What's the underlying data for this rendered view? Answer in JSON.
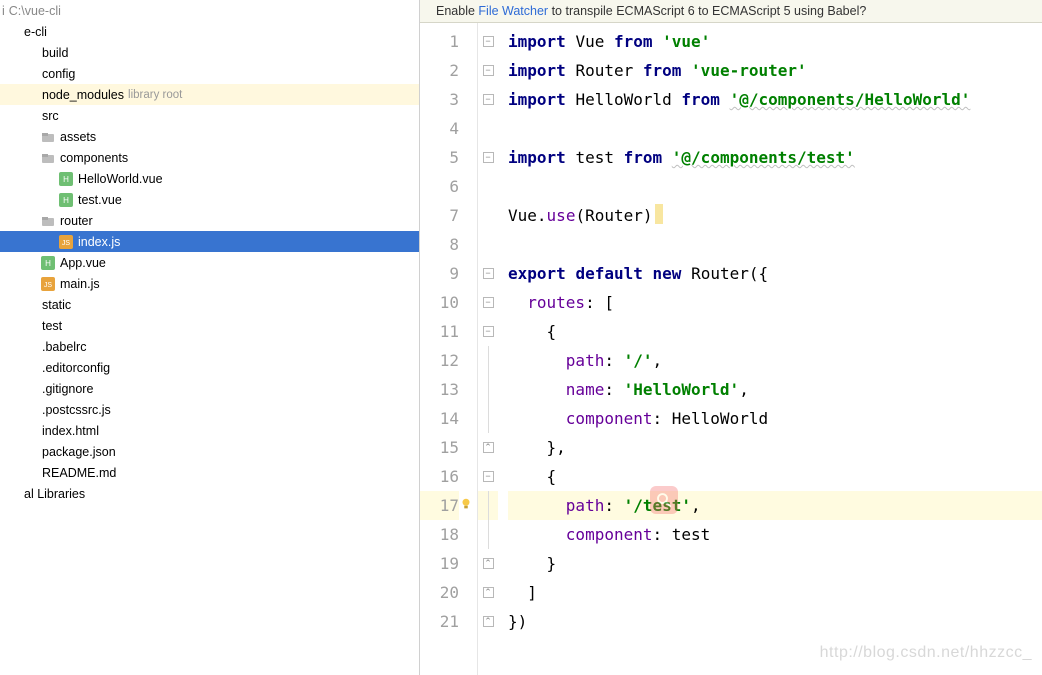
{
  "header": {
    "project_root_prefix": "i",
    "project_root_path": "C:\\vue-cli"
  },
  "notice": {
    "prefix": "Enable ",
    "link": "File Watcher",
    "suffix": " to transpile ECMAScript 6 to ECMAScript 5 using Babel?"
  },
  "watermark": "http://blog.csdn.net/hhzzcc_",
  "sidebar": {
    "items": [
      {
        "depth": 0,
        "icon": "root",
        "label": "C:\\vue-cli",
        "hint": "",
        "style": "root"
      },
      {
        "depth": 0,
        "icon": "none",
        "label": "e-cli",
        "hint": ""
      },
      {
        "depth": 1,
        "icon": "none",
        "label": "build",
        "hint": ""
      },
      {
        "depth": 1,
        "icon": "none",
        "label": "config",
        "hint": ""
      },
      {
        "depth": 1,
        "icon": "none",
        "label": "node_modules",
        "hint": "library root",
        "style": "lib"
      },
      {
        "depth": 1,
        "icon": "none",
        "label": "src",
        "hint": ""
      },
      {
        "depth": 2,
        "icon": "folder",
        "label": "assets",
        "hint": ""
      },
      {
        "depth": 2,
        "icon": "folder",
        "label": "components",
        "hint": ""
      },
      {
        "depth": 3,
        "icon": "vuefile",
        "label": "HelloWorld.vue",
        "hint": ""
      },
      {
        "depth": 3,
        "icon": "vuefile",
        "label": "test.vue",
        "hint": ""
      },
      {
        "depth": 2,
        "icon": "folder",
        "label": "router",
        "hint": ""
      },
      {
        "depth": 3,
        "icon": "jsfile",
        "label": "index.js",
        "hint": "",
        "style": "selected"
      },
      {
        "depth": 2,
        "icon": "vuefile",
        "label": "App.vue",
        "hint": ""
      },
      {
        "depth": 2,
        "icon": "jsfile",
        "label": "main.js",
        "hint": ""
      },
      {
        "depth": 1,
        "icon": "none",
        "label": "static",
        "hint": ""
      },
      {
        "depth": 1,
        "icon": "none",
        "label": "test",
        "hint": ""
      },
      {
        "depth": 1,
        "icon": "none",
        "label": ".babelrc",
        "hint": ""
      },
      {
        "depth": 1,
        "icon": "none",
        "label": ".editorconfig",
        "hint": ""
      },
      {
        "depth": 1,
        "icon": "none",
        "label": ".gitignore",
        "hint": ""
      },
      {
        "depth": 1,
        "icon": "none",
        "label": ".postcssrc.js",
        "hint": ""
      },
      {
        "depth": 1,
        "icon": "none",
        "label": "index.html",
        "hint": ""
      },
      {
        "depth": 1,
        "icon": "none",
        "label": "package.json",
        "hint": ""
      },
      {
        "depth": 1,
        "icon": "none",
        "label": "README.md",
        "hint": ""
      },
      {
        "depth": 0,
        "icon": "none",
        "label": "al Libraries",
        "hint": ""
      }
    ]
  },
  "editor": {
    "highlight_line": 17,
    "line_count": 21,
    "lines_html": [
      "<span class='kw'>import</span> <span class='id'>Vue</span> <span class='kw'>from</span> <span class='str'>'vue'</span>",
      "<span class='kw'>import</span> <span class='id'>Router</span> <span class='kw'>from</span> <span class='str'>'vue-router'</span>",
      "<span class='kw'>import</span> <span class='id'>HelloWorld</span> <span class='kw'>from</span> <span class='str wavy'>'@/components/HelloWorld'</span>",
      "",
      "<span class='kw'>import</span> <span class='id'>test</span> <span class='kw'>from</span> <span class='str wavy'>'@/components/test'</span>",
      "",
      "<span class='id'>Vue</span>.<span class='prop'>use</span>(<span class='id'>Router</span>)<span class='caret-mark'></span>",
      "",
      "<span class='kw'>export</span> <span class='kw'>default</span> <span class='kw'>new</span> <span class='id'>Router</span>({",
      "  <span class='prop'>routes</span>: [",
      "    {",
      "      <span class='prop'>path</span>: <span class='str'>'/'</span>,",
      "      <span class='prop'>name</span>: <span class='str'>'HelloWorld'</span>,",
      "      <span class='prop'>component</span>: <span class='id'>HelloWorld</span>",
      "    },",
      "    {",
      "      <span class='prop'>path</span>: <span class='str'>'/test'</span>,",
      "      <span class='prop'>component</span>: <span class='id'>test</span>",
      "    }",
      "  ]",
      "})"
    ],
    "fold_open": [
      1,
      2,
      3,
      5,
      9,
      10,
      11,
      16
    ],
    "fold_close": [
      15,
      19,
      20,
      21
    ]
  }
}
